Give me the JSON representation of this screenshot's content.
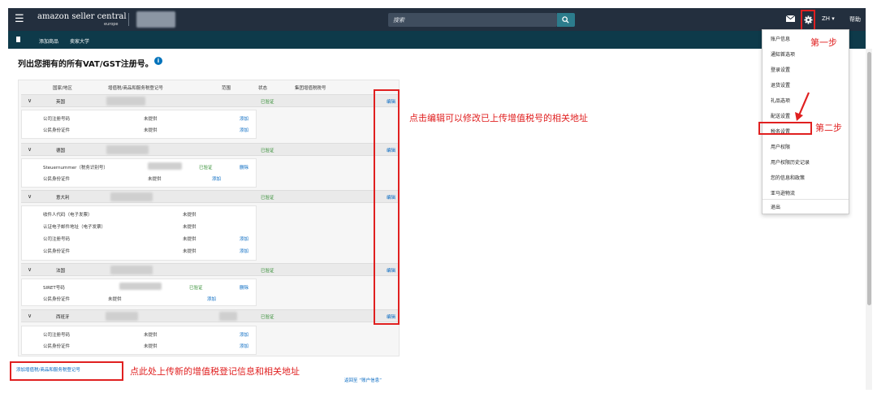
{
  "topbar": {
    "logo": "amazon seller central",
    "logo_sub": "europe",
    "search_placeholder": "搜索",
    "lang": "ZH ▾",
    "help": "帮助"
  },
  "navbar": {
    "items": [
      "添加商品",
      "卖家大学"
    ]
  },
  "page": {
    "title": "列出您拥有的所有VAT/GST注册号。",
    "info_glyph": "i"
  },
  "table": {
    "headers": [
      "国家/地区",
      "增值税/商品和服务税登记号",
      "范围",
      "状态",
      "集团增值税税号"
    ],
    "countries": [
      {
        "name": "英国",
        "status": "已验证",
        "edit": "编辑",
        "details": [
          {
            "label": "公司注册号码",
            "status": "未提供",
            "action": "添加"
          },
          {
            "label": "公民身份证件",
            "status": "未提供",
            "action": "添加"
          }
        ]
      },
      {
        "name": "德国",
        "status": "已验证",
        "edit": "编辑",
        "details": [
          {
            "label": "Steuernummer（税务识别号）",
            "status": "已验证",
            "action": "删除"
          },
          {
            "label": "公民身份证件",
            "status": "未提供",
            "action": "添加"
          }
        ]
      },
      {
        "name": "意大利",
        "status": "已验证",
        "edit": "编辑",
        "details": [
          {
            "label": "收件人代码（电子发票）",
            "status": "未提供",
            "action": ""
          },
          {
            "label": "认证电子邮件地址（电子发票）",
            "status": "未提供",
            "action": ""
          },
          {
            "label": "公司注册号码",
            "status": "未提供",
            "action": "添加"
          },
          {
            "label": "公民身份证件",
            "status": "未提供",
            "action": "添加"
          }
        ]
      },
      {
        "name": "法国",
        "status": "已验证",
        "edit": "编辑",
        "details": [
          {
            "label": "SIRET号码",
            "status": "已验证",
            "action": "删除"
          },
          {
            "label": "公民身份证件",
            "status": "未提供",
            "action": "添加"
          }
        ]
      },
      {
        "name": "西班牙",
        "status": "已验证",
        "edit": "编辑",
        "details": [
          {
            "label": "公司注册号码",
            "status": "未提供",
            "action": "添加"
          },
          {
            "label": "公民身份证件",
            "status": "未提供",
            "action": "添加"
          }
        ]
      }
    ]
  },
  "links": {
    "add_vat": "添加增值税/商品和服务税登记号",
    "back": "返回至 “账户信息”"
  },
  "annotations": {
    "edit_hint": "点击编辑可以修改已上传增值税号的相关地址",
    "upload_hint": "点此处上传新的增值税登记信息和相关地址",
    "step1": "第一步",
    "step2": "第二步"
  },
  "menu": {
    "items": [
      "账户信息",
      "通知首选项",
      "登录设置",
      "退货设置",
      "礼品选项",
      "配送设置",
      "税务设置",
      "用户权限",
      "用户权限历史记录",
      "您的信息和政策",
      "亚马逊物流",
      "退出"
    ]
  },
  "colors": {
    "topbar": "#232f3e",
    "navbar": "#0e3a4a",
    "annotation": "#e02020",
    "link": "#0066c0",
    "verified": "#2e8b2e"
  }
}
